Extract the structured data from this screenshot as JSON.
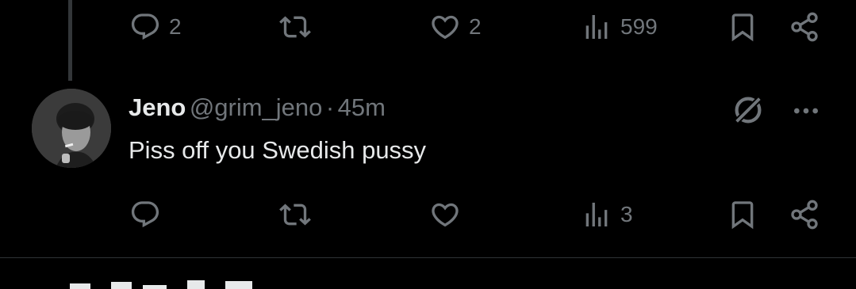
{
  "top_tweet": {
    "actions": {
      "reply_count": "2",
      "like_count": "2",
      "view_count": "599"
    }
  },
  "reply": {
    "author_name": "Jeno",
    "handle": "@grim_jeno",
    "separator": "·",
    "time": "45m",
    "text": "Piss off you Swedish pussy",
    "actions": {
      "view_count": "3"
    }
  },
  "colors": {
    "background": "#000000",
    "text_primary": "#e7e9ea",
    "text_secondary": "#71767b",
    "divider": "#2f3336"
  }
}
